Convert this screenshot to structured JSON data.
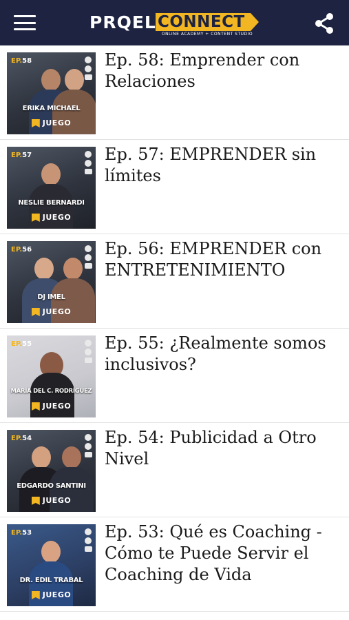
{
  "app": {
    "logo_left": "PRQEL",
    "logo_right": "CONNECT",
    "tagline": "ONLINE ACADEMY + CONTENT STUDIO",
    "menu_icon": "hamburger-menu-icon",
    "share_icon": "share-icon",
    "colors": {
      "header_bg": "#1d2340",
      "accent": "#f2b622"
    }
  },
  "brand_label": "JUEGO",
  "episodes": [
    {
      "tag": "EP.",
      "num": "58",
      "guest": "ERIKA MICHAEL",
      "title": "Ep. 58: Emprender con Relaciones"
    },
    {
      "tag": "EP.",
      "num": "57",
      "guest": "NESLIE BERNARDI",
      "title": "Ep. 57: EMPRENDER sin límites"
    },
    {
      "tag": "EP.",
      "num": "56",
      "guest": "DJ IMEL",
      "title": "Ep. 56: EMPRENDER con ENTRETENIMIENTO"
    },
    {
      "tag": "EP.",
      "num": "55",
      "guest": "MARÍA DEL C. RODRÍGUEZ",
      "title": "Ep. 55: ¿Realmente somos inclusivos?"
    },
    {
      "tag": "EP.",
      "num": "54",
      "guest": "EDGARDO SANTINI",
      "title": "Ep. 54: Publicidad a Otro Nivel"
    },
    {
      "tag": "EP.",
      "num": "53",
      "guest": "DR. EDIL TRABAL",
      "title": "Ep. 53: Qué es Coaching - Cómo te Puede Servir el Coaching de Vida"
    }
  ]
}
